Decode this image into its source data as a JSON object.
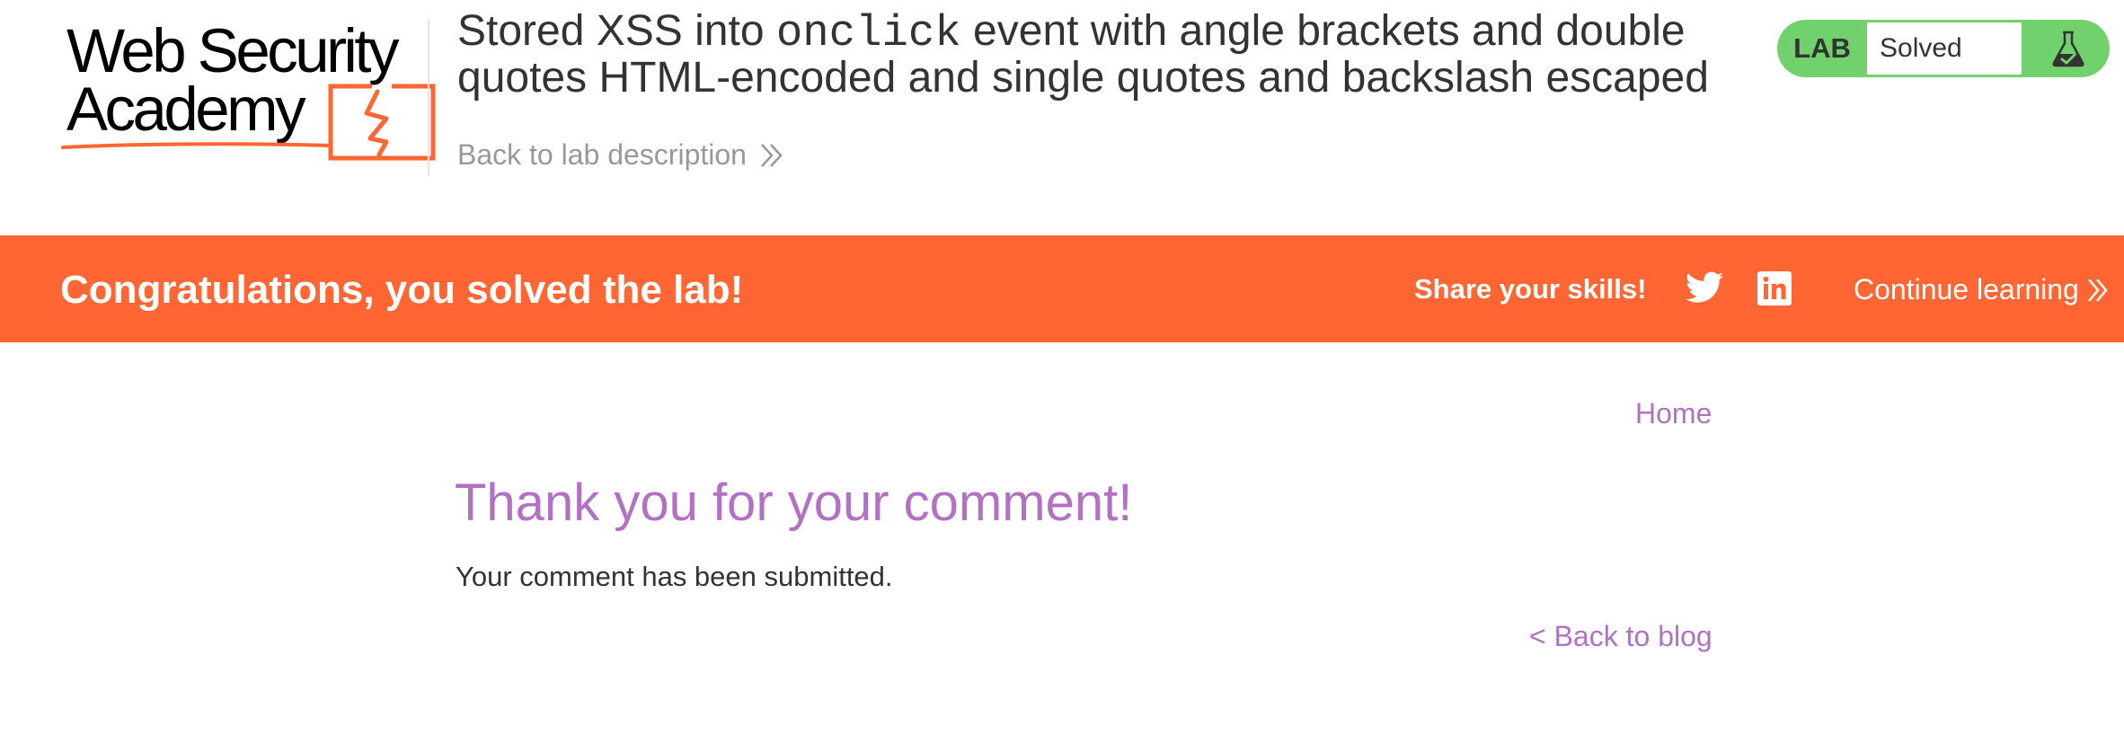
{
  "brand": {
    "logo_line1": "Web Security",
    "logo_line2": "Academy",
    "accent_color": "#ff6633"
  },
  "header": {
    "title_part1": "Stored XSS into ",
    "title_code": "onclick",
    "title_part2": " event with angle brackets and double quotes HTML-encoded and single quotes and backslash escaped",
    "back_link": "Back to lab description",
    "lab_badge": {
      "label": "LAB",
      "status": "Solved",
      "status_color": "#70d16d",
      "icon": "flask-solved-icon"
    }
  },
  "banner": {
    "message": "Congratulations, you solved the lab!",
    "share_label": "Share your skills!",
    "share_icons": [
      "twitter-icon",
      "linkedin-icon"
    ],
    "continue_label": "Continue learning",
    "background": "#ff6633"
  },
  "nav": {
    "home_label": "Home"
  },
  "main": {
    "heading": "Thank you for your comment!",
    "message": "Your comment has been submitted.",
    "back_to_blog": "< Back to blog",
    "link_color": "#b371c3"
  }
}
